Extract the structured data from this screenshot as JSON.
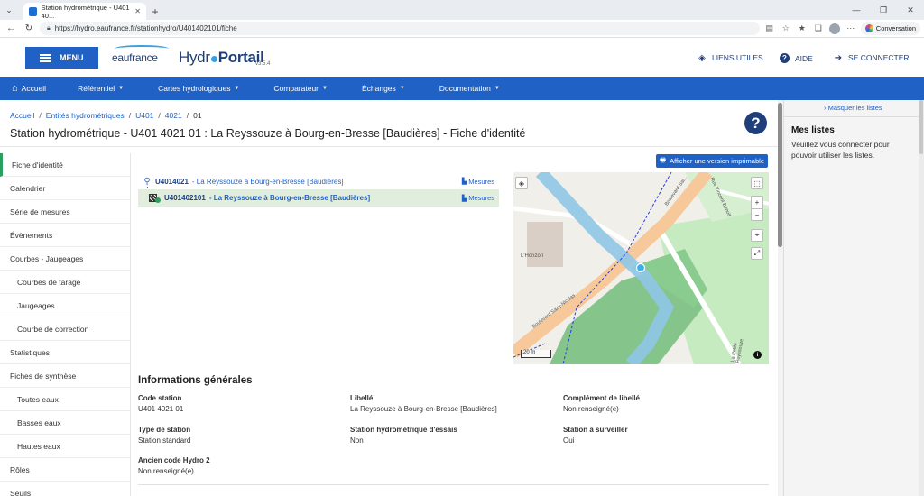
{
  "browser": {
    "tab_title": "Station hydrométrique - U401 40...",
    "url": "https://hydro.eaufrance.fr/stationhydro/U401402101/fiche",
    "conversation_label": "Conversation"
  },
  "header": {
    "menu_label": "MENU",
    "logo_eau": "eaufrance",
    "logo_hydro": "Hydr",
    "logo_portail": "Portail",
    "version": "v3.5.4",
    "liens_utiles": "LIENS UTILES",
    "aide": "AIDE",
    "se_connecter": "SE CONNECTER"
  },
  "nav": {
    "accueil": "Accueil",
    "referentiel": "Référentiel",
    "cartes": "Cartes hydrologiques",
    "comparateur": "Comparateur",
    "echanges": "Échanges",
    "documentation": "Documentation"
  },
  "breadcrumb": [
    "Accueil",
    "Entités hydrométriques",
    "U401",
    "4021",
    "01"
  ],
  "page_title": "Station hydrométrique - U401 4021 01 : La Reyssouze à Bourg-en-Bresse [Baudières] - Fiche d'identité",
  "sidenav": [
    "Fiche d'identité",
    "Calendrier",
    "Série de mesures",
    "Évènements",
    "Courbes - Jaugeages",
    "Courbes de tarage",
    "Jaugeages",
    "Courbe de correction",
    "Statistiques",
    "Fiches de synthèse",
    "Toutes eaux",
    "Basses eaux",
    "Hautes eaux",
    "Rôles",
    "Seuils"
  ],
  "print_label": "Afficher une version imprimable",
  "tree": {
    "site_code": "U4014021",
    "site_label": "- La Reyssouze à Bourg-en-Bresse [Baudières]",
    "station_code": "U401402101",
    "station_label": "- La Reyssouze à Bourg-en-Bresse [Baudières]",
    "mesures": "Mesures"
  },
  "map": {
    "label_horizon": "L'Horizon",
    "label_boulevard": "Boulevard Saint-Nicolas",
    "label_rue": "Rue Vincent Benoit",
    "label_petite": "La Petite Reyssouze",
    "label_bd2": "Boulevard Sai...",
    "scale": "20 m"
  },
  "info": {
    "title": "Informations générales",
    "code_station_label": "Code station",
    "code_station_value": "U401 4021 01",
    "libelle_label": "Libellé",
    "libelle_value": "La Reyssouze à Bourg-en-Bresse [Baudières]",
    "complement_label": "Complément de libellé",
    "complement_value": "Non renseigné(e)",
    "type_label": "Type de station",
    "type_value": "Station standard",
    "essais_label": "Station hydrométrique d'essais",
    "essais_value": "Non",
    "surveiller_label": "Station à surveiller",
    "surveiller_value": "Oui",
    "ancien_label": "Ancien code Hydro 2",
    "ancien_value": "Non renseigné(e)"
  },
  "right_panel": {
    "hide_label": "Masquer les listes",
    "title": "Mes listes",
    "text": "Veuillez vous connecter pour pouvoir utiliser les listes."
  }
}
